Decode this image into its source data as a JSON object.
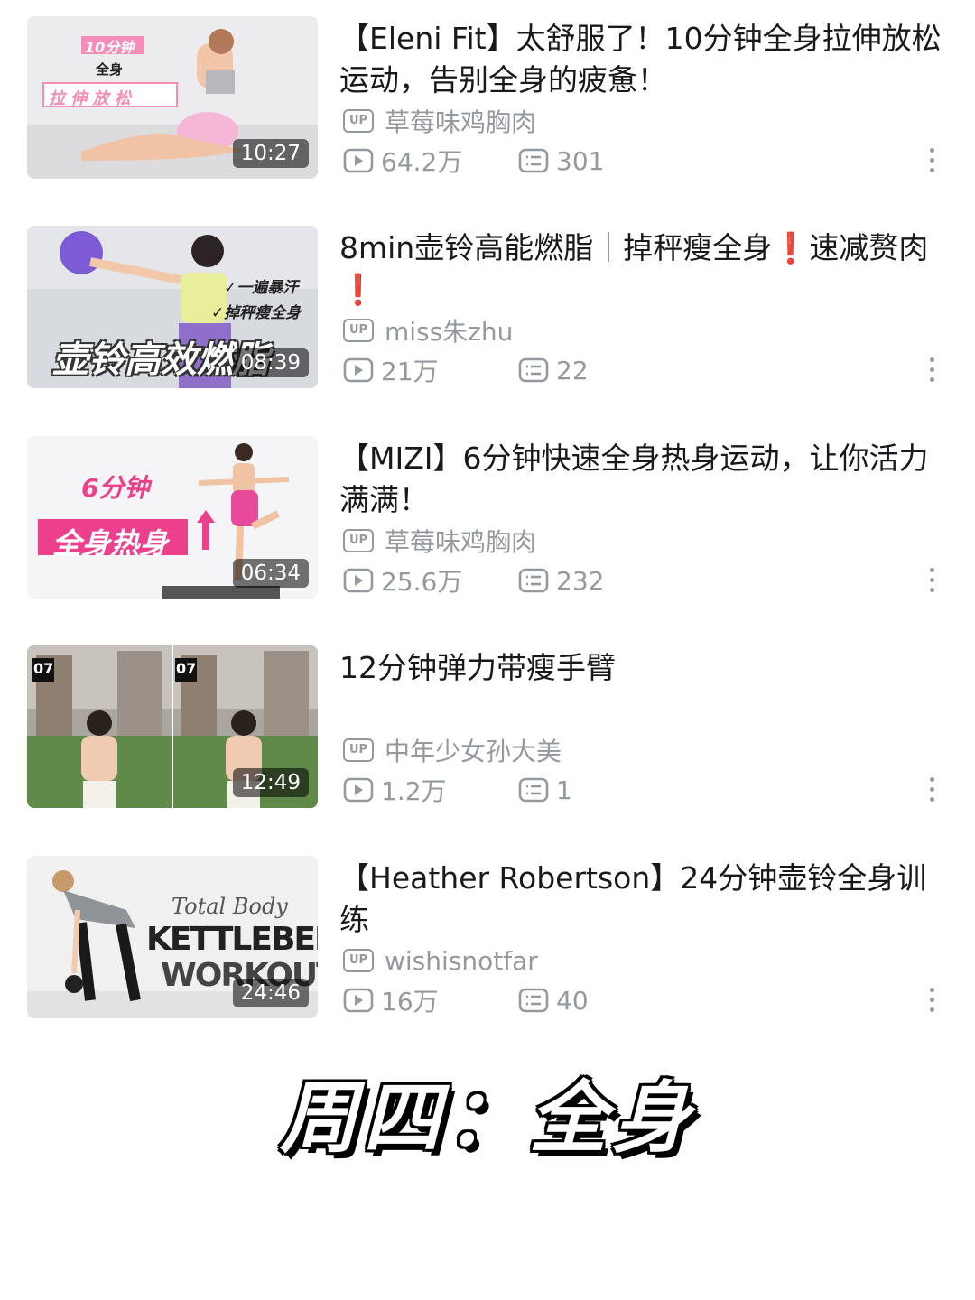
{
  "videos": [
    {
      "title": "【Eleni  Fit】太舒服了！10分钟全身拉伸放松运动，告别全身的疲惫！",
      "uploader": "草莓味鸡胸肉",
      "views": "64.2万",
      "comments": "301",
      "duration": "10:27",
      "thumb_text": [
        "10分钟",
        "全身",
        "拉 伸 放 松"
      ]
    },
    {
      "title": "8min壶铃高能燃脂｜掉秤瘦全身❗速减赘肉❗",
      "uploader": "miss朱zhu",
      "views": "21万",
      "comments": "22",
      "duration": "08:39",
      "thumb_text": [
        "✓一遍暴汗",
        "✓掉秤瘦全身",
        "壶铃高效燃脂"
      ]
    },
    {
      "title": "【MIZI】6分钟快速全身热身运动，让你活力满满！",
      "uploader": "草莓味鸡胸肉",
      "views": "25.6万",
      "comments": "232",
      "duration": "06:34",
      "thumb_text": [
        "6分钟",
        "全身热身"
      ]
    },
    {
      "title": "12分钟弹力带瘦手臂",
      "uploader": "中年少女孙大美",
      "views": "1.2万",
      "comments": "1",
      "duration": "12:49",
      "thumb_text": [
        "07",
        "07"
      ]
    },
    {
      "title": "【Heather  Robertson】24分钟壶铃全身训练",
      "uploader": "wishisnotfar",
      "views": "16万",
      "comments": "40",
      "duration": "24:46",
      "thumb_text": [
        "Total Body",
        "KETTLEBELL",
        "WORKOUT"
      ]
    }
  ],
  "up_badge": "UP",
  "footer_caption": "周四：全身",
  "icons": {
    "play": "play-count-icon",
    "comment": "comment-count-icon",
    "more": "more-vertical-icon"
  },
  "colors": {
    "title": "#18191c",
    "meta": "#9499a0",
    "accent_pink": "#ec3f8c",
    "emoji_red": "#e02424"
  }
}
